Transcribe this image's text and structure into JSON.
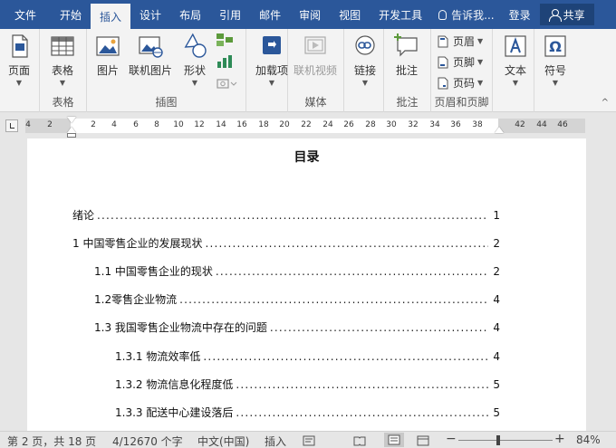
{
  "tabs": [
    {
      "label": "文件",
      "active": false
    },
    {
      "label": "开始",
      "active": false
    },
    {
      "label": "插入",
      "active": true
    },
    {
      "label": "设计",
      "active": false
    },
    {
      "label": "布局",
      "active": false
    },
    {
      "label": "引用",
      "active": false
    },
    {
      "label": "邮件",
      "active": false
    },
    {
      "label": "审阅",
      "active": false
    },
    {
      "label": "视图",
      "active": false
    },
    {
      "label": "开发工具",
      "active": false
    }
  ],
  "tell_me": "告诉我...",
  "login": "登录",
  "share": "共享",
  "ribbon": {
    "pages": {
      "btn": "页面",
      "group": ""
    },
    "table": {
      "btn": "表格",
      "group": "表格"
    },
    "illustrations": {
      "picture": "图片",
      "online_picture": "联机图片",
      "shapes": "形状",
      "group": "插图"
    },
    "addins": {
      "btn": "加载项"
    },
    "media": {
      "btn": "联机视频",
      "group": "媒体"
    },
    "links": {
      "btn": "链接"
    },
    "comments": {
      "btn": "批注",
      "group": "批注"
    },
    "header_footer": {
      "header": "页眉",
      "footer": "页脚",
      "page_number": "页码",
      "group": "页眉和页脚"
    },
    "text": {
      "btn": "文本"
    },
    "symbols": {
      "btn": "符号"
    }
  },
  "ruler": {
    "numbers": [
      "4",
      "2",
      "2",
      "4",
      "6",
      "8",
      "10",
      "12",
      "14",
      "16",
      "18",
      "20",
      "22",
      "24",
      "26",
      "28",
      "30",
      "32",
      "34",
      "36",
      "38",
      "42",
      "44",
      "46"
    ]
  },
  "document": {
    "title": "目录",
    "toc": [
      {
        "text": "绪论",
        "page": "1"
      },
      {
        "text": "1 中国零售企业的发展现状",
        "page": "2"
      },
      {
        "text": "1.1 中国零售企业的现状",
        "page": "2"
      },
      {
        "text": "1.2零售企业物流",
        "page": "4"
      },
      {
        "text": "1.3 我国零售企业物流中存在的问题",
        "page": "4"
      },
      {
        "text": "1.3.1 物流效率低",
        "page": "4"
      },
      {
        "text": "1.3.2 物流信息化程度低",
        "page": "5"
      },
      {
        "text": "1.3.3 配送中心建设落后",
        "page": "5"
      }
    ]
  },
  "status": {
    "page": "第 2 页，共 18 页",
    "words": "4/12670 个字",
    "language": "中文(中国)",
    "mode": "插入",
    "zoom": "84%",
    "zoom_fraction": 0.42
  },
  "colors": {
    "accent": "#2b579a"
  }
}
